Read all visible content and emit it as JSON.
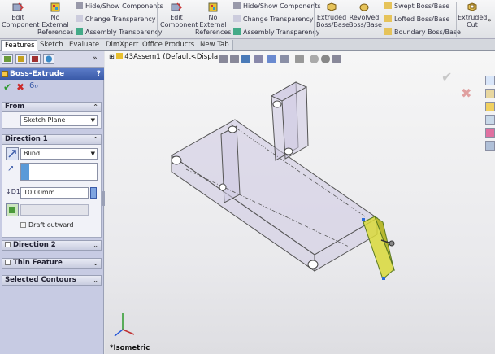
{
  "ribbon": {
    "edit_component_1": "Edit\nComponent",
    "no_external_refs_1": "No\nExternal\nReferences",
    "hide_show_1": "Hide/Show Components",
    "change_transparency_1": "Change Transparency",
    "assembly_transparency_1": "Assembly Transparency",
    "edit_component_2": "Edit\nComponent",
    "no_external_refs_2": "No\nExternal\nReferences",
    "hide_show_2": "Hide/Show Components",
    "change_transparency_2": "Change Transparency",
    "assembly_transparency_2": "Assembly Transparency",
    "extruded_boss": "Extruded\nBoss/Base",
    "revolved_boss": "Revolved\nBoss/Base",
    "swept_boss": "Swept Boss/Base",
    "lofted_boss": "Lofted Boss/Base",
    "boundary_boss": "Boundary Boss/Base",
    "extruded_cut": "Extruded\nCut"
  },
  "tabs": [
    "Features",
    "Sketch",
    "Evaluate",
    "DimXpert",
    "Office Products",
    "New Tab"
  ],
  "panel": {
    "feature_title": "Boss-Extrude",
    "from_header": "From",
    "from_value": "Sketch Plane",
    "direction1_header": "Direction 1",
    "end_condition": "Blind",
    "depth_value": "10.00mm",
    "draft_outward": "Draft outward",
    "direction2_header": "Direction 2",
    "thin_feature_header": "Thin Feature",
    "selected_contours_header": "Selected Contours"
  },
  "viewport": {
    "tree_title": "43Assem1 (Default<Displa...",
    "view_label": "*Isometric"
  },
  "colors": {
    "feature_header": "#3a5aa8",
    "panel_bg": "#c7cbe3",
    "selection_highlight": "#d9d93a",
    "ok_check": "#2e9a2e",
    "cancel_x": "#cc2a2a"
  }
}
